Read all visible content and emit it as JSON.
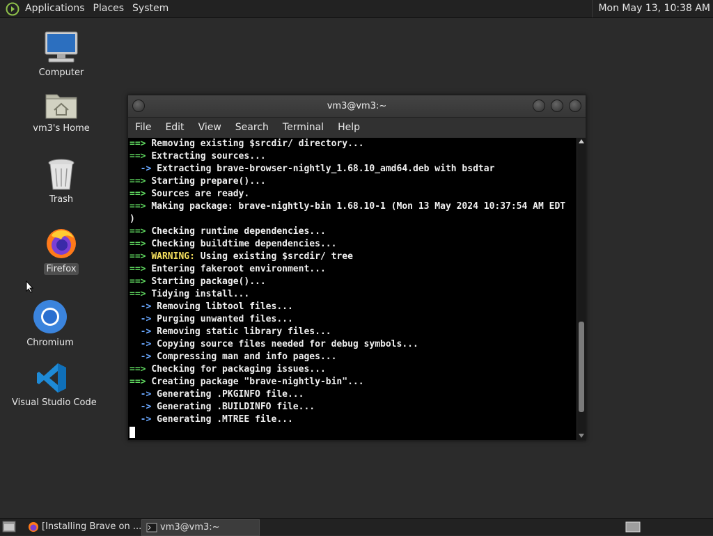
{
  "top_panel": {
    "menus": [
      "Applications",
      "Places",
      "System"
    ],
    "clock": "Mon May 13, 10:38 AM"
  },
  "desktop": {
    "icons": [
      {
        "label": "Computer",
        "icon": "computer-icon"
      },
      {
        "label": "vm3's Home",
        "icon": "home-folder-icon"
      },
      {
        "label": "Trash",
        "icon": "trash-icon"
      },
      {
        "label": "Firefox",
        "icon": "firefox-icon",
        "selected": true
      },
      {
        "label": "Chromium",
        "icon": "chromium-icon"
      },
      {
        "label": "Visual Studio Code",
        "icon": "vscode-icon"
      }
    ]
  },
  "terminal": {
    "title": "vm3@vm3:~",
    "menu": [
      "File",
      "Edit",
      "View",
      "Search",
      "Terminal",
      "Help"
    ],
    "lines": [
      {
        "p": "==> ",
        "pc": "g",
        "t": "Removing existing $srcdir/ directory..."
      },
      {
        "p": "==> ",
        "pc": "g",
        "t": "Extracting sources..."
      },
      {
        "p": "  -> ",
        "pc": "b",
        "t": "Extracting brave-browser-nightly_1.68.10_amd64.deb with bsdtar"
      },
      {
        "p": "==> ",
        "pc": "g",
        "t": "Starting prepare()..."
      },
      {
        "p": "==> ",
        "pc": "g",
        "t": "Sources are ready."
      },
      {
        "p": "==> ",
        "pc": "g",
        "t": "Making package: brave-nightly-bin 1.68.10-1 (Mon 13 May 2024 10:37:54 AM EDT"
      },
      {
        "p": "",
        "pc": "",
        "t": ")"
      },
      {
        "p": "==> ",
        "pc": "g",
        "t": "Checking runtime dependencies..."
      },
      {
        "p": "==> ",
        "pc": "g",
        "t": "Checking buildtime dependencies..."
      },
      {
        "p": "==> ",
        "pc": "g",
        "w": "WARNING:",
        "t": " Using existing $srcdir/ tree"
      },
      {
        "p": "==> ",
        "pc": "g",
        "t": "Entering fakeroot environment..."
      },
      {
        "p": "==> ",
        "pc": "g",
        "t": "Starting package()..."
      },
      {
        "p": "==> ",
        "pc": "g",
        "t": "Tidying install..."
      },
      {
        "p": "  -> ",
        "pc": "b",
        "t": "Removing libtool files..."
      },
      {
        "p": "  -> ",
        "pc": "b",
        "t": "Purging unwanted files..."
      },
      {
        "p": "  -> ",
        "pc": "b",
        "t": "Removing static library files..."
      },
      {
        "p": "  -> ",
        "pc": "b",
        "t": "Copying source files needed for debug symbols..."
      },
      {
        "p": "  -> ",
        "pc": "b",
        "t": "Compressing man and info pages..."
      },
      {
        "p": "==> ",
        "pc": "g",
        "t": "Checking for packaging issues..."
      },
      {
        "p": "==> ",
        "pc": "g",
        "t": "Creating package \"brave-nightly-bin\"..."
      },
      {
        "p": "  -> ",
        "pc": "b",
        "t": "Generating .PKGINFO file..."
      },
      {
        "p": "  -> ",
        "pc": "b",
        "t": "Generating .BUILDINFO file..."
      },
      {
        "p": "  -> ",
        "pc": "b",
        "t": "Generating .MTREE file..."
      }
    ],
    "scroll_position": 0.9
  },
  "taskbar": {
    "tasks": [
      {
        "label": "[Installing Brave on ...",
        "icon": "firefox-icon",
        "active": false
      },
      {
        "label": "vm3@vm3:~",
        "icon": "terminal-icon",
        "active": true
      }
    ]
  },
  "colors": {
    "prompt_green": "#5fd75f",
    "prompt_blue": "#6aa8ff",
    "warning_yellow": "#f6e05e"
  }
}
